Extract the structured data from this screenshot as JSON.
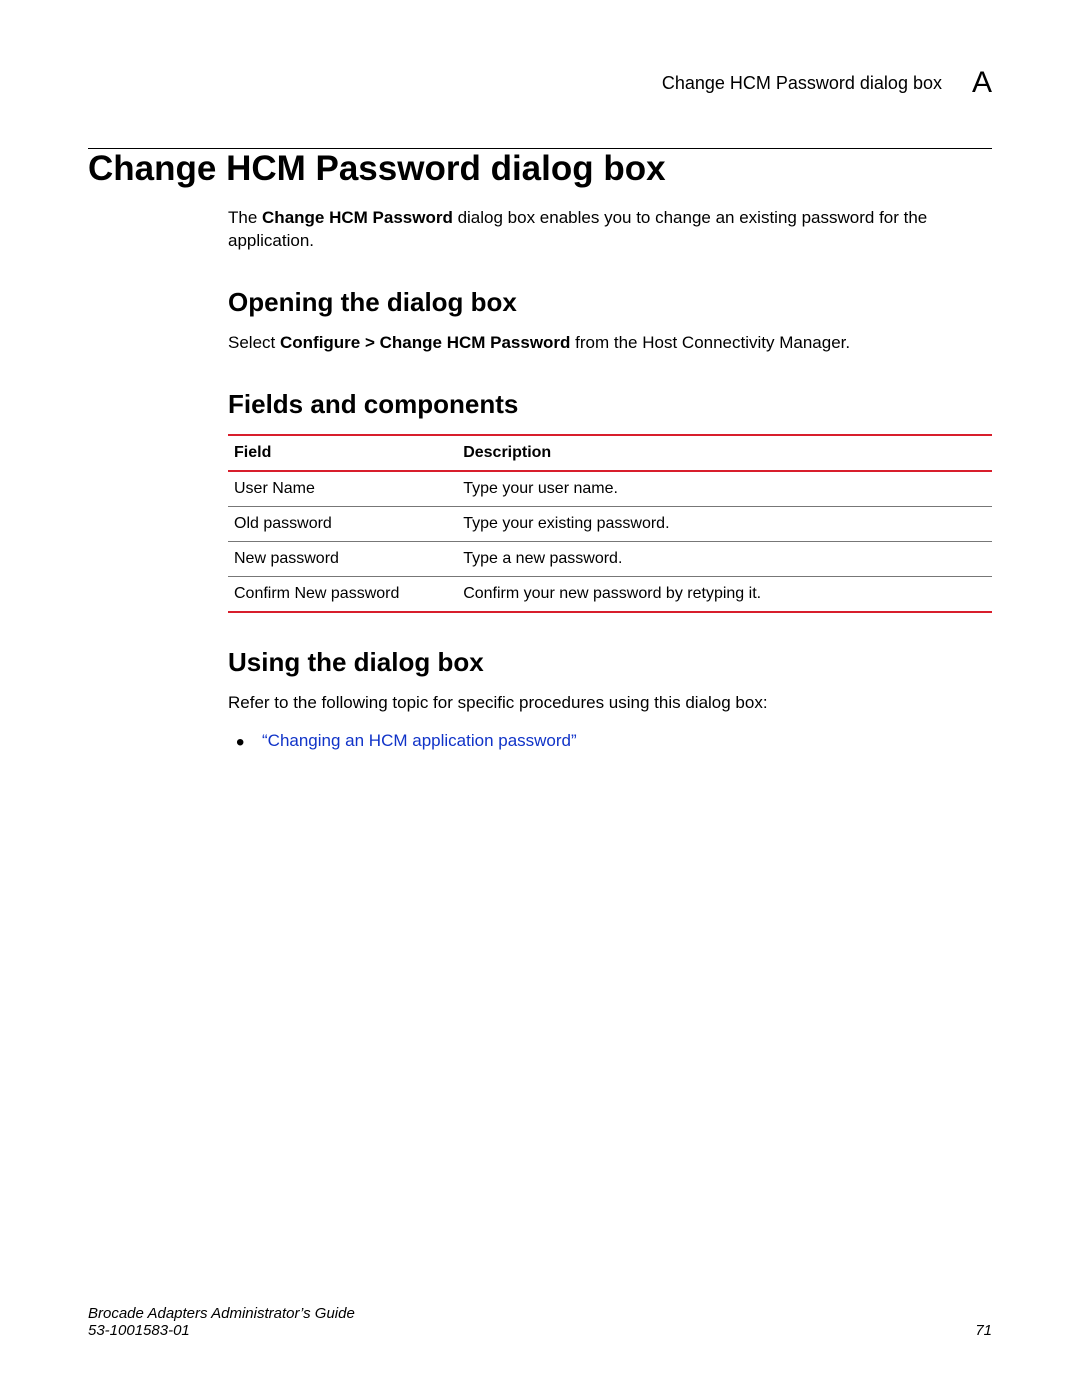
{
  "header": {
    "running_title": "Change HCM Password dialog box",
    "appendix_letter": "A"
  },
  "title": "Change HCM Password dialog box",
  "intro": {
    "prefix": "The ",
    "bold": "Change HCM Password",
    "suffix": " dialog box enables you to change an existing password for the application."
  },
  "sections": {
    "opening": {
      "heading": "Opening the dialog box",
      "line": {
        "prefix": "Select ",
        "bold": "Configure > Change HCM Password",
        "suffix": " from the Host Connectivity Manager."
      }
    },
    "fields": {
      "heading": "Fields and components",
      "columns": {
        "field": "Field",
        "description": "Description"
      },
      "rows": [
        {
          "field": "User Name",
          "description": "Type your user name."
        },
        {
          "field": "Old password",
          "description": "Type your existing password."
        },
        {
          "field": "New password",
          "description": "Type a new password."
        },
        {
          "field": "Confirm New password",
          "description": "Confirm your new password by retyping it."
        }
      ]
    },
    "using": {
      "heading": "Using the dialog box",
      "lead": "Refer to the following topic for specific procedures using this dialog box:",
      "links": [
        "“Changing an HCM application password”"
      ]
    }
  },
  "footer": {
    "book": "Brocade Adapters Administrator’s Guide",
    "docnum": "53-1001583-01",
    "page": "71"
  }
}
